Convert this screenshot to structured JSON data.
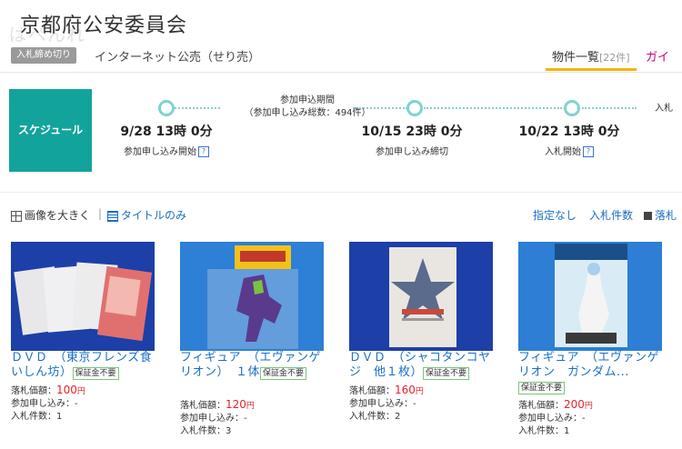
{
  "header": {
    "title": "京都府公安委員会",
    "watermark": "ぱぺんれ",
    "status_badge": "入札締め切り",
    "subtitle": "インターネット公売（せり売）",
    "tab_list_label": "物件一覧",
    "tab_list_count": "[22件]",
    "tab_guide_label": "ガイ"
  },
  "schedule": {
    "label": "スケジュール",
    "period_title": "参加申込期間",
    "period_total": "（参加申し込み総数：494件）",
    "milestones": [
      {
        "date": "9/28 13時 0分",
        "caption": "参加申し込み開始",
        "help": "?"
      },
      {
        "date": "10/15 23時 0分",
        "caption": "参加申し込み締切",
        "help": ""
      },
      {
        "date": "10/22 13時 0分",
        "caption": "入札開始",
        "help": "?"
      }
    ],
    "next_label": "入札"
  },
  "view": {
    "large_image": "画像を大きく",
    "separator": "|",
    "title_only": "タイトルのみ",
    "sort_none": "指定なし",
    "sort_bids": "入札件数",
    "sort_price": "落札"
  },
  "items": [
    {
      "title": "ＤＶＤ　（東京フレンズ食いしん坊）",
      "badge": "保証金不要",
      "price_label": "落札価額：",
      "price": "100",
      "yen": "円",
      "apply_label": "参加申し込み：-",
      "bids_label": "入札件数：1"
    },
    {
      "title": "フィギュア　（エヴァンゲリオン）　１体",
      "badge": "保証金不要",
      "price_label": "落札価額：",
      "price": "120",
      "yen": "円",
      "apply_label": "参加申し込み：-",
      "bids_label": "入札件数：3"
    },
    {
      "title": "ＤＶＤ　（シャコタンコヤジ　他１枚）",
      "badge": "保証金不要",
      "price_label": "落札価額：",
      "price": "160",
      "yen": "円",
      "apply_label": "参加申し込み：-",
      "bids_label": "入札件数：2"
    },
    {
      "title": "フィギュア　（エヴァンゲリオン　ガンダム...",
      "badge": "保証金不要",
      "price_label": "落札価額：",
      "price": "200",
      "yen": "円",
      "apply_label": "参加申し込み：-",
      "bids_label": "入札件数：1"
    }
  ],
  "colors": {
    "schedule": "#12a39c",
    "link": "#1a6fc4",
    "price": "#e8202a",
    "tab_accent": "#f4b400"
  }
}
